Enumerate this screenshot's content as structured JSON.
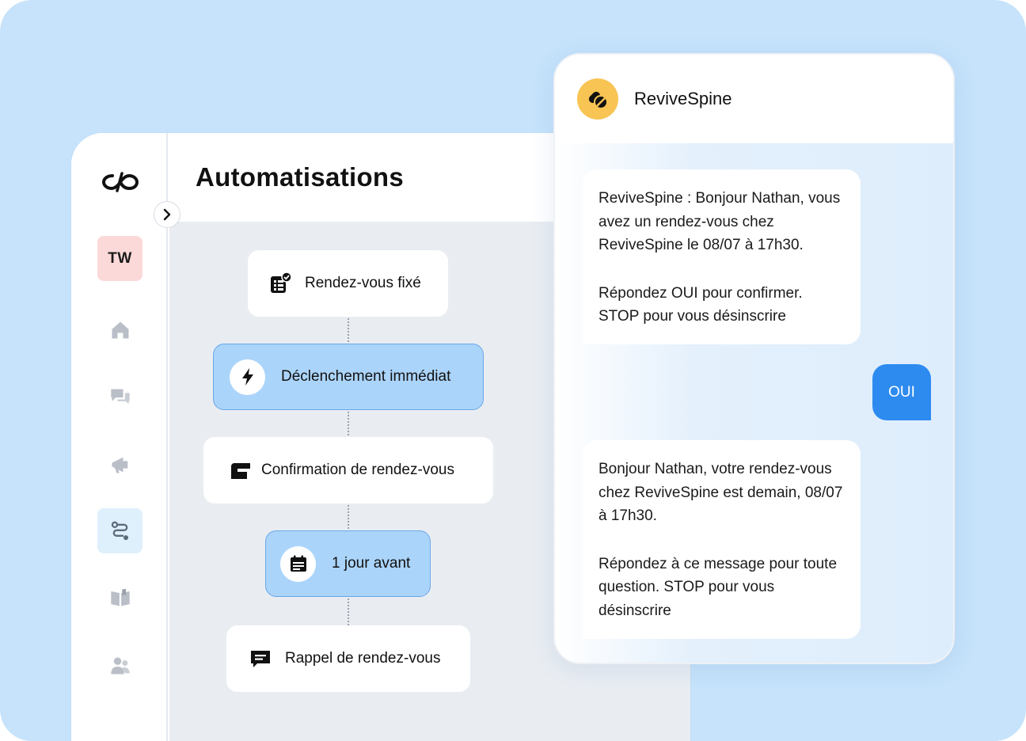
{
  "app": {
    "page_title": "Automatisations",
    "avatar_initials": "TW",
    "nav": [
      {
        "name": "home",
        "icon": "home-icon"
      },
      {
        "name": "conversations",
        "icon": "chat-bubbles-icon"
      },
      {
        "name": "campaigns",
        "icon": "megaphone-icon"
      },
      {
        "name": "automations",
        "icon": "workflow-icon",
        "active": true
      },
      {
        "name": "knowledge",
        "icon": "book-icon"
      },
      {
        "name": "contacts",
        "icon": "users-icon"
      }
    ]
  },
  "flow": {
    "nodes": [
      {
        "label": "Rendez-vous fixé",
        "icon": "clipboard-check-icon",
        "style": "white"
      },
      {
        "label": "Déclenchement immédiat",
        "icon": "lightning-icon",
        "style": "blue"
      },
      {
        "label": "Confirmation de rendez-vous",
        "icon": "message-icon",
        "style": "white"
      },
      {
        "label": "1 jour avant",
        "icon": "calendar-icon",
        "style": "blue"
      },
      {
        "label": "Rappel de rendez-vous",
        "icon": "chat-icon",
        "style": "white"
      }
    ]
  },
  "chat": {
    "brand": "ReviveSpine",
    "messages": [
      {
        "direction": "in",
        "paragraphs": [
          "ReviveSpine : Bonjour Nathan, vous avez un rendez-vous chez ReviveSpine le 08/07 à 17h30.",
          "Répondez OUI pour confirmer. STOP pour vous désinscrire"
        ]
      },
      {
        "direction": "out",
        "text": "OUI"
      },
      {
        "direction": "in",
        "paragraphs": [
          "Bonjour Nathan, votre rendez-vous chez ReviveSpine est demain, 08/07 à 17h30.",
          "Répondez à ce message pour toute question. STOP pour vous désinscrire"
        ]
      }
    ]
  },
  "colors": {
    "backdrop": "#c6e3fb",
    "node_blue": "#abd4fa",
    "outgoing_bubble": "#2d8bf0",
    "brand_badge": "#f8c453",
    "avatar_bg": "#fcd9d9"
  }
}
